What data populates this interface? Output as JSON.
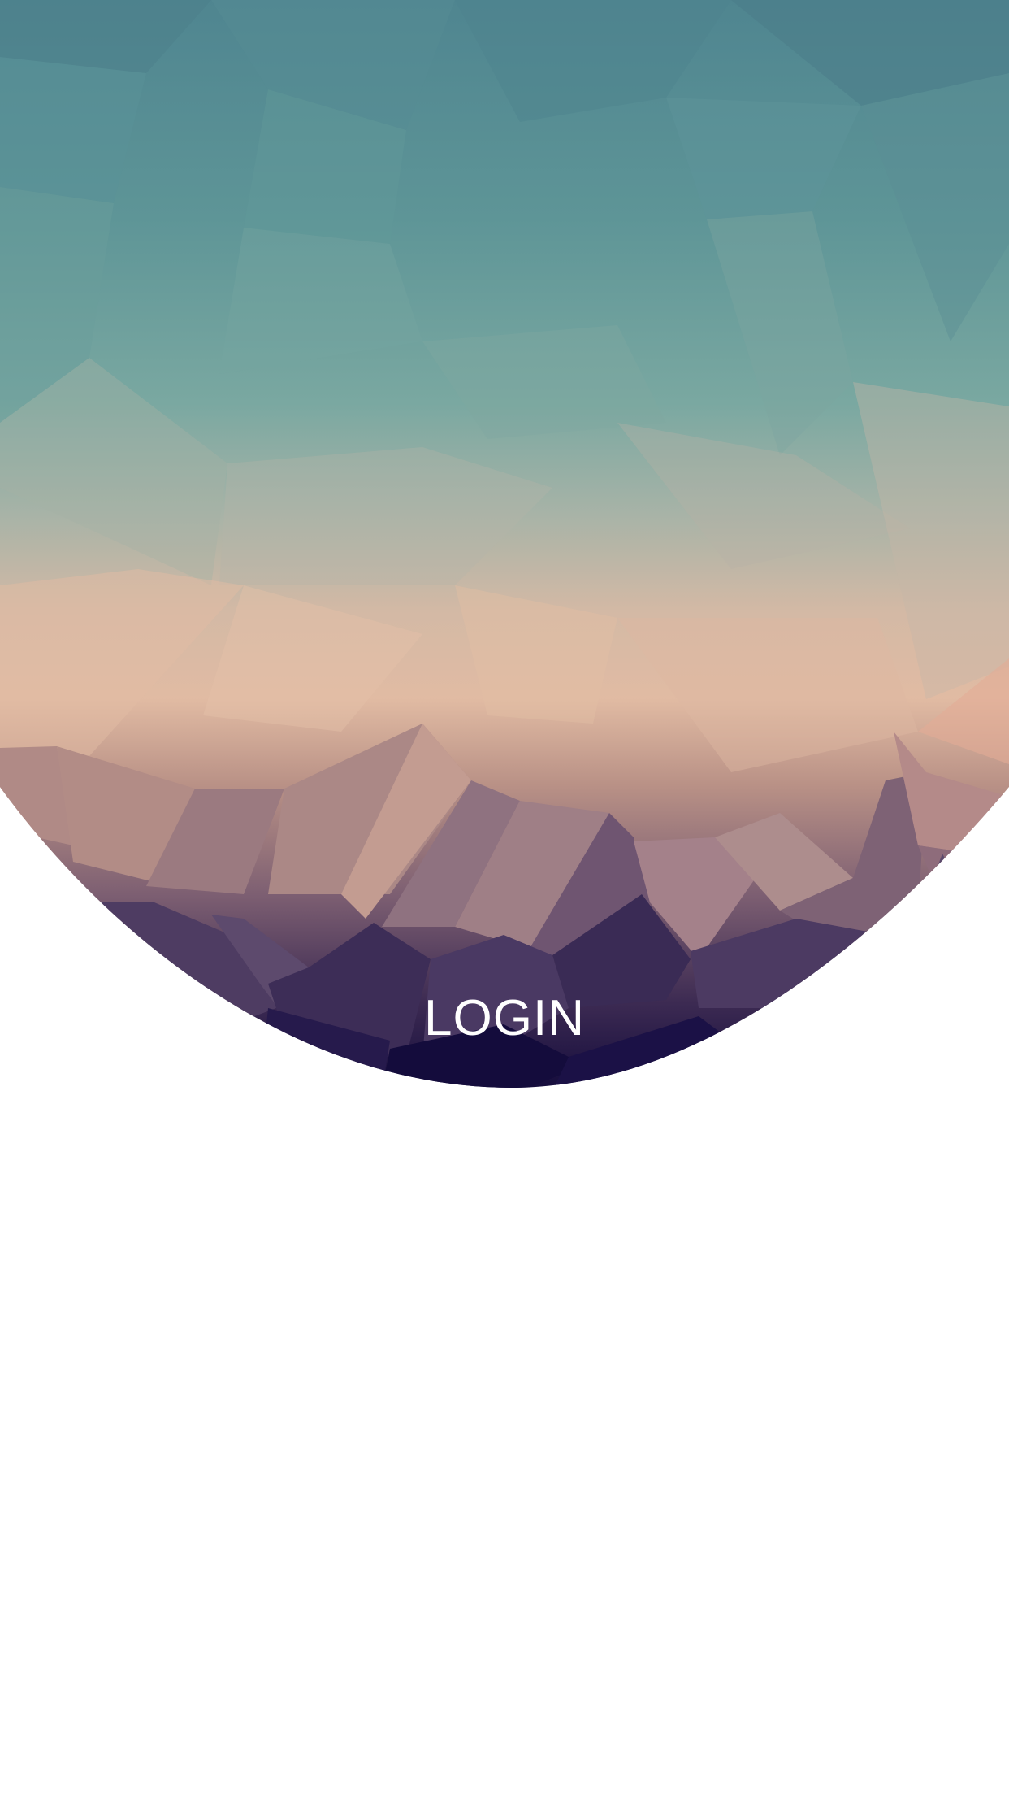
{
  "header": {
    "title": "LOGIN",
    "background_image": "low-poly-mountain-sunset",
    "colors": {
      "sky_top": "#4f8590",
      "sky_mid": "#6ea19b",
      "horizon": "#e1bba3",
      "peaks": "#a98586",
      "base": "#140c3c"
    }
  }
}
